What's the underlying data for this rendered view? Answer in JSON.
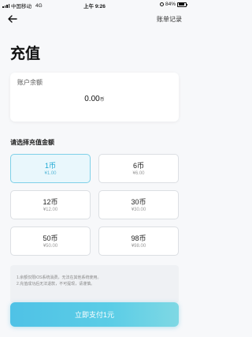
{
  "status_bar": {
    "carrier": "中国移动",
    "network": "4G",
    "time": "上午 9:26",
    "battery": "84%",
    "battery_level": 0.84
  },
  "nav": {
    "back_icon": "arrow-left-icon",
    "history_label": "账单记录"
  },
  "page_title": "充值",
  "balance": {
    "label": "账户余额",
    "value": "0.00",
    "unit": "币"
  },
  "section_title": "请选择充值金额",
  "options": [
    {
      "name": "1币",
      "price": "¥1.00",
      "selected": true
    },
    {
      "name": "6币",
      "price": "¥6.00",
      "selected": false
    },
    {
      "name": "12币",
      "price": "¥12.00",
      "selected": false
    },
    {
      "name": "30币",
      "price": "¥30.00",
      "selected": false
    },
    {
      "name": "50币",
      "price": "¥50.00",
      "selected": false
    },
    {
      "name": "98币",
      "price": "¥98.00",
      "selected": false
    }
  ],
  "notes": [
    "1.余额仅限iOS系统消费，无法在其他系统使用。",
    "2.充值成功后无法退款，不可提现，请谨慎。"
  ],
  "pay_button": "立即支付1元",
  "colors": {
    "accent": "#1ba8d4",
    "selected_bg": "#e9f7fc",
    "pay_gradient_start": "#4fc2e6",
    "pay_gradient_end": "#7fd8e4"
  }
}
